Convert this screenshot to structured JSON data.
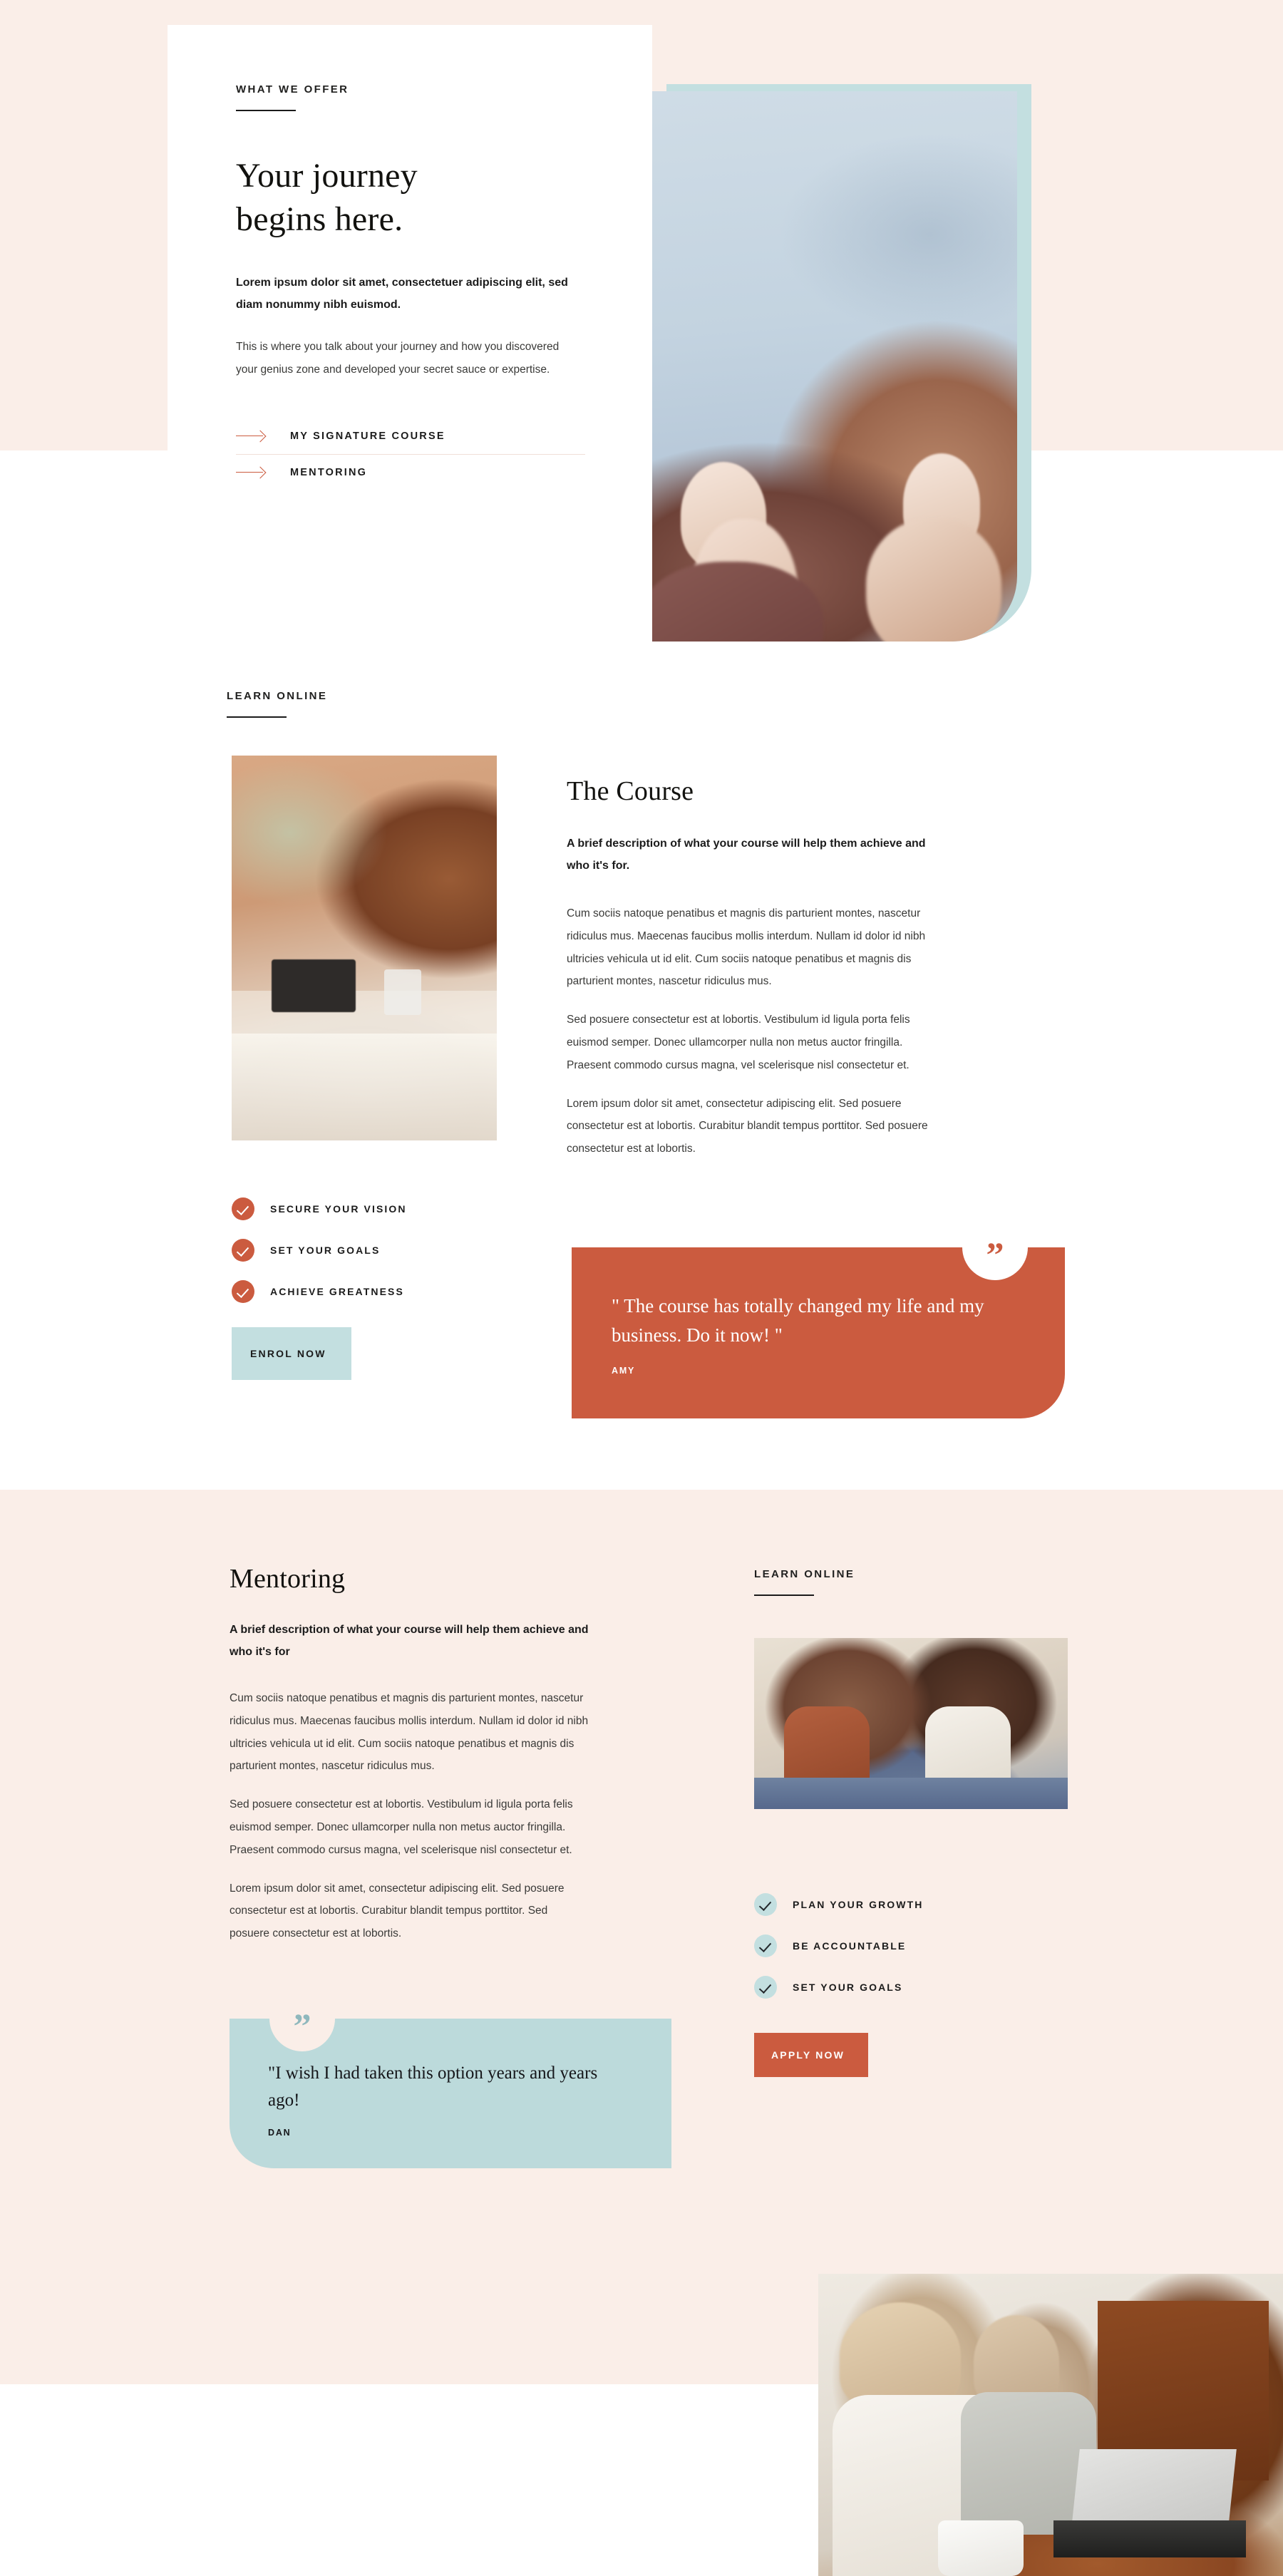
{
  "hero": {
    "eyebrow": "WHAT WE OFFER",
    "title_line1": "Your journey",
    "title_line2": "begins here.",
    "lead": "Lorem ipsum dolor sit amet, consectetuer adipiscing elit, sed diam nonummy nibh euismod.",
    "paragraph": "This is where you talk about your journey and how you discovered your genius zone and developed your secret sauce or expertise.",
    "links": [
      {
        "label": "MY SIGNATURE COURSE",
        "icon": "arrow-right-icon"
      },
      {
        "label": "MENTORING",
        "icon": "arrow-right-icon"
      }
    ],
    "photo_alt": "hands-raised-peace-signs-photo"
  },
  "course": {
    "eyebrow": "LEARN ONLINE",
    "title": "The Course",
    "lead": "A brief description of what your course will help them achieve and who it's for.",
    "paragraphs": [
      "Cum sociis natoque penatibus et magnis dis parturient montes, nascetur ridiculus mus. Maecenas faucibus mollis interdum. Nullam id dolor id nibh ultricies vehicula ut id elit. Cum sociis natoque penatibus et magnis dis parturient montes, nascetur ridiculus mus.",
      "Sed posuere consectetur est at lobortis. Vestibulum id ligula porta felis euismod semper. Donec ullamcorper nulla non metus auctor fringilla. Praesent commodo cursus magna, vel scelerisque nisl consectetur et.",
      "Lorem ipsum dolor sit amet, consectetur adipiscing elit. Sed posuere consectetur est at lobortis. Curabitur blandit tempus porttitor. Sed posuere consectetur est at lobortis."
    ],
    "checklist": [
      "SECURE YOUR VISION",
      "SET YOUR GOALS",
      "ACHIEVE GREATNESS"
    ],
    "cta": "ENROL NOW",
    "photo_alt": "coffee-table-brick-wall-photo",
    "testimonial": {
      "quote": "\" The course has totally changed my life and my business. Do it now! \"",
      "author": "AMY",
      "badge_glyph": "”"
    }
  },
  "mentoring": {
    "title": "Mentoring",
    "lead": "A brief description of what your course will help them achieve and who it's for",
    "paragraphs": [
      "Cum sociis natoque penatibus et magnis dis parturient montes, nascetur ridiculus mus. Maecenas faucibus mollis interdum. Nullam id dolor id nibh ultricies vehicula ut id elit. Cum sociis natoque penatibus et magnis dis parturient montes, nascetur ridiculus mus.",
      "Sed posuere consectetur est at lobortis. Vestibulum id ligula porta felis euismod semper. Donec ullamcorper nulla non metus auctor fringilla. Praesent commodo cursus magna, vel scelerisque nisl consectetur et.",
      "Lorem ipsum dolor sit amet, consectetur adipiscing elit. Sed posuere consectetur est at lobortis. Curabitur blandit tempus porttitor. Sed posuere consectetur est at lobortis."
    ],
    "eyebrow": "LEARN ONLINE",
    "checklist": [
      "PLAN YOUR GROWTH",
      "BE ACCOUNTABLE",
      "SET YOUR GOALS"
    ],
    "cta": "APPLY NOW",
    "photo_alt": "two-women-sitting-smiling-photo",
    "testimonial": {
      "quote": "\"I wish I had taken this option years and years ago!",
      "author": "DAN",
      "badge_glyph": "”"
    }
  },
  "bottom": {
    "photo_alt": "two-women-laptop-cafe-photo"
  },
  "colors": {
    "cream": "#faeee8",
    "orange": "#cb5b3f",
    "teal": "#c3dfe0",
    "teal_card": "#bcdadb",
    "ink": "#1b1b1b",
    "white": "#ffffff"
  }
}
